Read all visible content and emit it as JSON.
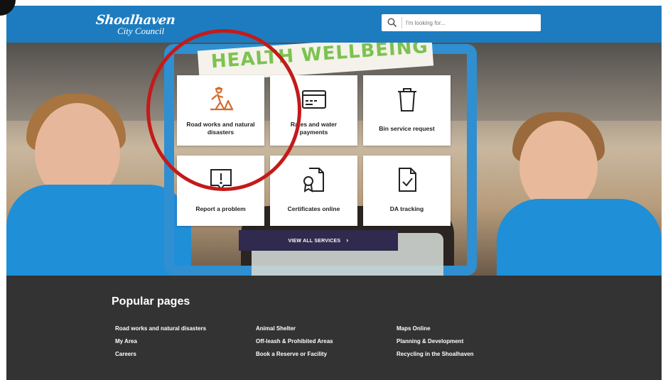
{
  "header": {
    "logo_top": "Shoalhaven",
    "logo_bottom": "City Council",
    "brand_color": "#1d7cbf"
  },
  "search": {
    "placeholder": "I'm looking for...",
    "icon": "search-icon"
  },
  "hero": {
    "banner_text": "HEALTH WELLBEING"
  },
  "services": [
    {
      "label": "Road works and natural disasters",
      "icon": "road-worker-icon"
    },
    {
      "label": "Rates and water payments",
      "icon": "payment-card-icon"
    },
    {
      "label": "Bin service request",
      "icon": "bin-icon"
    },
    {
      "label": "Report a problem",
      "icon": "report-problem-icon"
    },
    {
      "label": "Certificates online",
      "icon": "certificate-icon"
    },
    {
      "label": "DA tracking",
      "icon": "document-check-icon"
    }
  ],
  "view_all": {
    "label": "VIEW ALL SERVICES",
    "chevron": "›"
  },
  "popular": {
    "title": "Popular pages",
    "columns": [
      [
        "Road works and natural disasters",
        "My Area",
        "Careers"
      ],
      [
        "Animal Shelter",
        "Off-leash & Prohibited Areas",
        "Book a Reserve or Facility"
      ],
      [
        "Maps Online",
        "Planning & Development",
        "Recycling in the Shoalhaven"
      ]
    ]
  },
  "colors": {
    "accent": "#1d7cbf",
    "tile_icon": "#d36b2c",
    "button_bg": "#2f2a4e",
    "footer_bg": "#333333",
    "annotation": "#c41a1a"
  }
}
